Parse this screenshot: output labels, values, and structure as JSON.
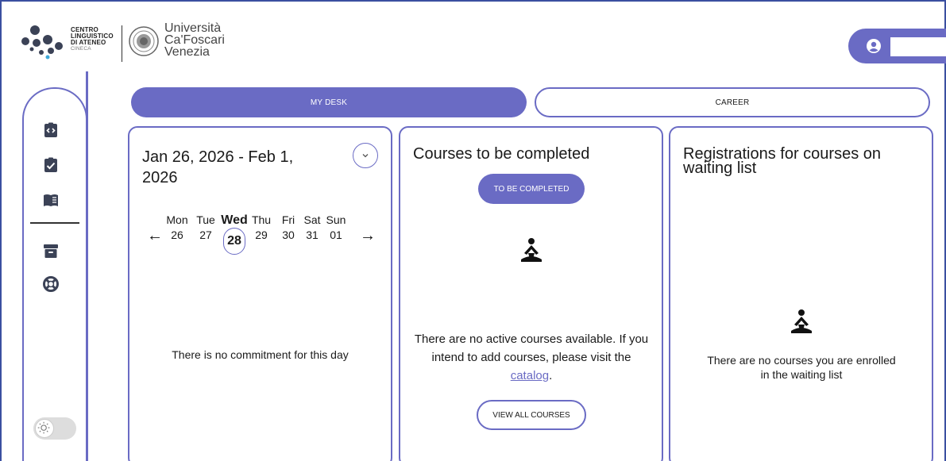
{
  "header": {
    "cla_lines": [
      "CENTRO",
      "LINGUISTICO",
      "DI ATENEO"
    ],
    "cla_sub": "CINECA",
    "uni_lines": [
      "Università",
      "Ca'Foscari",
      "Venezia"
    ]
  },
  "tabs": {
    "desk": "MY DESK",
    "career": "CAREER"
  },
  "calendar": {
    "range": "Jan 26, 2026 - Feb 1, 2026",
    "days": [
      {
        "name": "Mon",
        "date": "26"
      },
      {
        "name": "Tue",
        "date": "27"
      },
      {
        "name": "Wed",
        "date": "28"
      },
      {
        "name": "Thu",
        "date": "29"
      },
      {
        "name": "Fri",
        "date": "30"
      },
      {
        "name": "Sat",
        "date": "31"
      },
      {
        "name": "Sun",
        "date": "01"
      }
    ],
    "empty": "There is no commitment for this day"
  },
  "courses": {
    "title": "Courses to be completed",
    "filter_button": "TO BE COMPLETED",
    "empty_before": "There are no active courses available. If you intend to add courses, please visit the ",
    "empty_link": "catalog",
    "empty_after": ".",
    "view_all": "VIEW ALL COURSES"
  },
  "waiting": {
    "title": "Registrations for courses on waiting list",
    "empty": "There are no courses you are enrolled in the waiting list"
  },
  "colors": {
    "accent": "#6a6bc4",
    "frame": "#3a4fa0"
  },
  "icons": {
    "sidebar": [
      "code-clipboard-icon",
      "checklist-icon",
      "book-icon",
      "archive-icon",
      "lifebuoy-icon"
    ],
    "toggle": "sun-icon"
  }
}
